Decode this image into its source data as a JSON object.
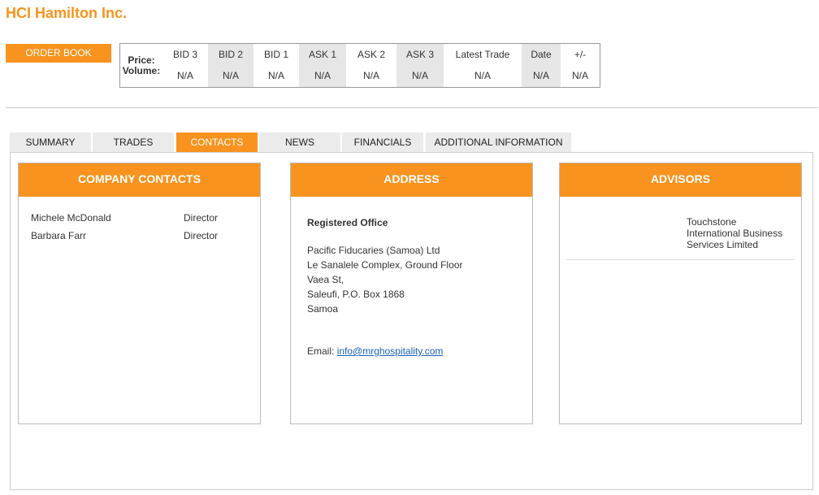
{
  "company": {
    "name": "HCI Hamilton Inc."
  },
  "order_book": {
    "button_label": "ORDER BOOK",
    "price_label": "Price:",
    "volume_label": "Volume:",
    "headers": [
      "BID 3",
      "BID 2",
      "BID 1",
      "ASK 1",
      "ASK 2",
      "ASK 3",
      "Latest Trade",
      "Date",
      "+/-"
    ],
    "values": [
      "N/A",
      "N/A",
      "N/A",
      "N/A",
      "N/A",
      "N/A",
      "N/A",
      "N/A",
      "N/A"
    ]
  },
  "tabs": [
    {
      "label": "SUMMARY",
      "active": false
    },
    {
      "label": "TRADES",
      "active": false
    },
    {
      "label": "CONTACTS",
      "active": true
    },
    {
      "label": "NEWS",
      "active": false
    },
    {
      "label": "FINANCIALS",
      "active": false
    },
    {
      "label": "ADDITIONAL INFORMATION",
      "active": false
    }
  ],
  "company_contacts": {
    "title": "COMPANY CONTACTS",
    "rows": [
      {
        "name": "Michele McDonald",
        "role": "Director"
      },
      {
        "name": "Barbara Farr",
        "role": "Director"
      }
    ]
  },
  "address": {
    "title": "ADDRESS",
    "office_label": "Registered Office",
    "lines": [
      "Pacific Fiducaries (Samoa) Ltd",
      "Le Sanalele Complex, Ground Floor",
      "Vaea St,",
      "Saleufi, P.O. Box 1868",
      "Samoa"
    ],
    "email_label": "Email:",
    "email": "info@mrghospitality.com"
  },
  "advisors": {
    "title": "ADVISORS",
    "name": "Touchstone International Business Services Limited"
  },
  "colors": {
    "accent": "#f7931e",
    "tab_inactive": "#ebebeb",
    "cell_shade": "#e6e6e6",
    "link": "#1a5fb4"
  }
}
